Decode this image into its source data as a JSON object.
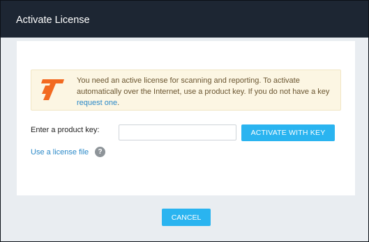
{
  "dialog": {
    "title": "Activate License"
  },
  "notice": {
    "icon": "product-logo-icon",
    "text": "You need an active license for scanning and reporting. To activate automatically over the Internet, use a product key. If you do not have a key ",
    "link_label": "request one",
    "trailing": "."
  },
  "form": {
    "key_label": "Enter a product key:",
    "key_value": "",
    "key_placeholder": "",
    "activate_label": "ACTIVATE WITH KEY",
    "license_file_label": "Use a license file",
    "help_icon": "question-icon"
  },
  "footer": {
    "cancel_label": "CANCEL"
  },
  "colors": {
    "titlebar": "#1d2633",
    "accent_button": "#2ab4f0",
    "link": "#2b89c8",
    "logo": "#f26a21",
    "notice_bg": "#fcf6e3"
  }
}
